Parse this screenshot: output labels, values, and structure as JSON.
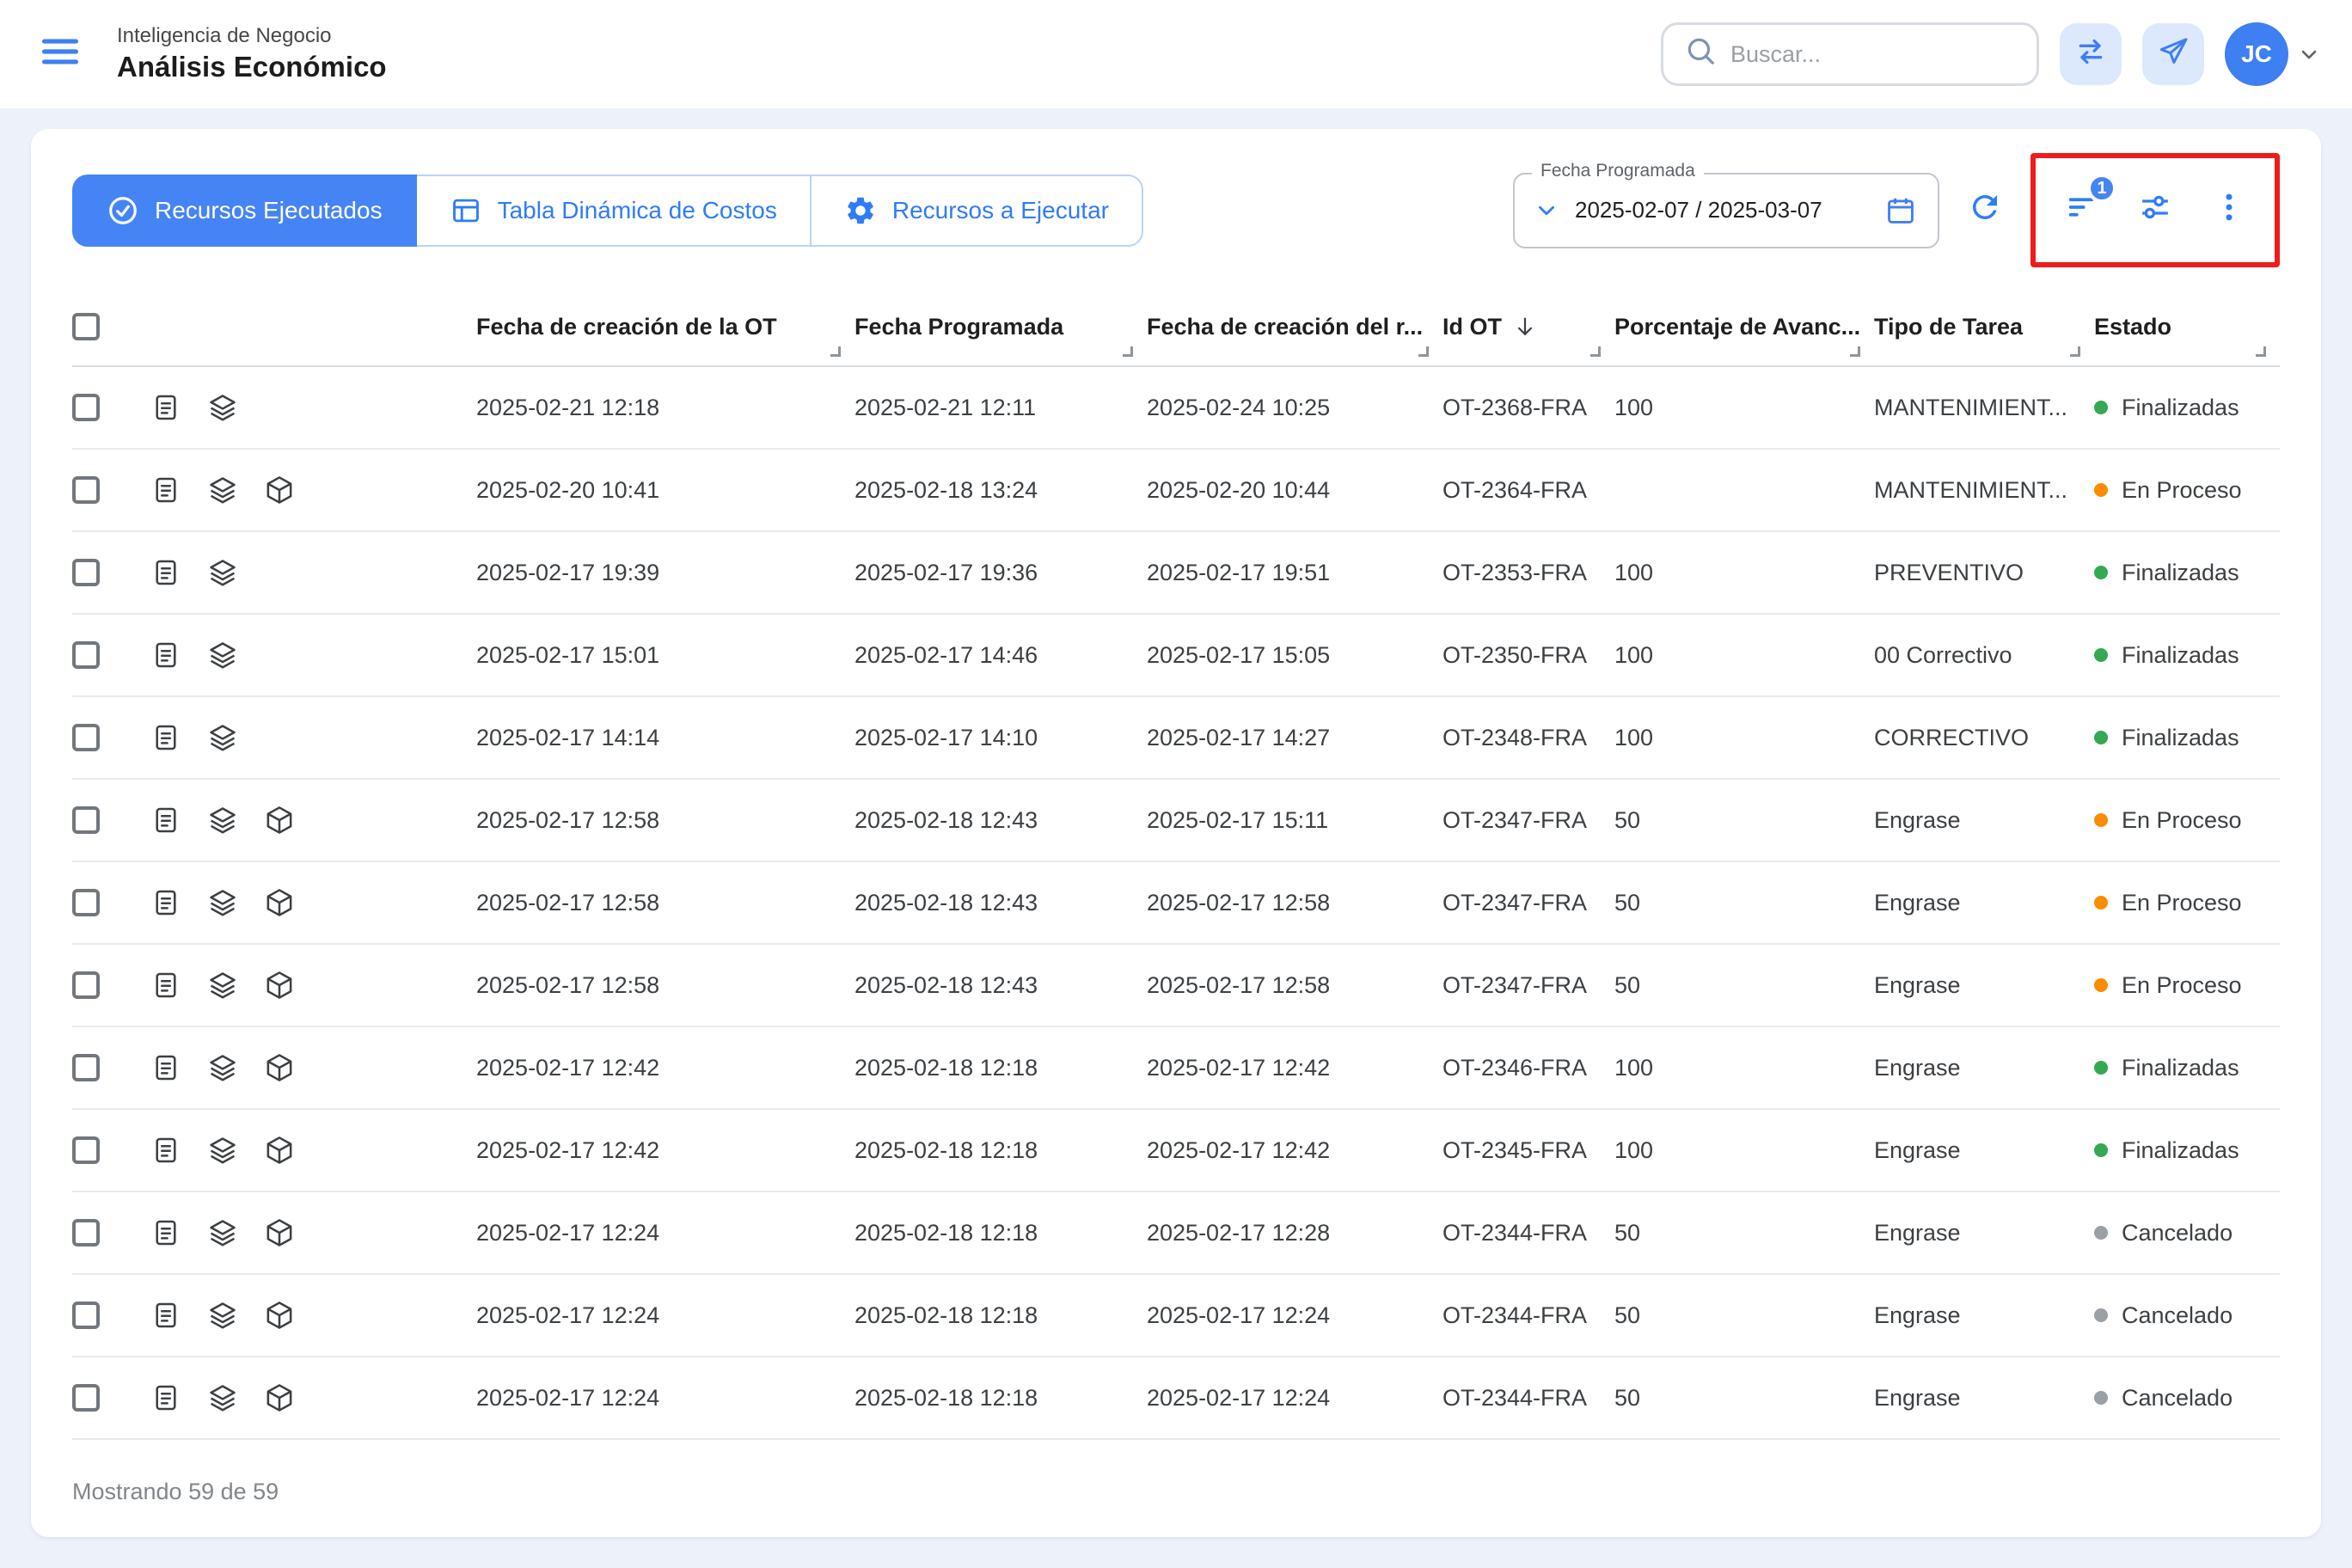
{
  "header": {
    "subtitle": "Inteligencia de Negocio",
    "title": "Análisis Económico",
    "search_placeholder": "Buscar...",
    "avatar_initials": "JC"
  },
  "tabs": [
    {
      "label": "Recursos Ejecutados",
      "icon": "check-circle-icon",
      "active": true
    },
    {
      "label": "Tabla Dinámica de Costos",
      "icon": "pivot-table-icon",
      "active": false
    },
    {
      "label": "Recursos a Ejecutar",
      "icon": "gear-icon",
      "active": false
    }
  ],
  "date_filter": {
    "label": "Fecha Programada",
    "value": "2025-02-07 / 2025-03-07"
  },
  "toolbar_icons": {
    "filter_badge_count": "1",
    "icons": [
      "refresh-icon",
      "filter-sort-icon",
      "tune-icon",
      "kebab-menu-icon"
    ]
  },
  "annotation": {
    "highlight_color": "#ee1c1c"
  },
  "colors": {
    "accent_blue": "#4584f4",
    "icon_blue": "#2f7cf6",
    "page_bg": "#edf1fa",
    "status_green": "#34a853",
    "status_orange": "#fb8c00",
    "status_gray": "#9aa0a6"
  },
  "table": {
    "columns": [
      "Fecha de creación de la OT",
      "Fecha Programada",
      "Fecha de creación del r...",
      "Id OT",
      "Porcentaje de Avanc...",
      "Tipo de Tarea",
      "Estado"
    ],
    "sorted_column": "Id OT",
    "rows": [
      {
        "creacion_ot": "2025-02-21 12:18",
        "programada": "2025-02-21 12:11",
        "creacion_recurso": "2025-02-24 10:25",
        "id_ot": "OT-2368-FRA",
        "porcentaje": "100",
        "tipo": "MANTENIMIENT...",
        "estado": "Finalizadas",
        "estado_color": "green",
        "has_cube": false
      },
      {
        "creacion_ot": "2025-02-20 10:41",
        "programada": "2025-02-18 13:24",
        "creacion_recurso": "2025-02-20 10:44",
        "id_ot": "OT-2364-FRA",
        "porcentaje": "",
        "tipo": "MANTENIMIENT...",
        "estado": "En Proceso",
        "estado_color": "orange",
        "has_cube": true
      },
      {
        "creacion_ot": "2025-02-17 19:39",
        "programada": "2025-02-17 19:36",
        "creacion_recurso": "2025-02-17 19:51",
        "id_ot": "OT-2353-FRA",
        "porcentaje": "100",
        "tipo": "PREVENTIVO",
        "estado": "Finalizadas",
        "estado_color": "green",
        "has_cube": false
      },
      {
        "creacion_ot": "2025-02-17 15:01",
        "programada": "2025-02-17 14:46",
        "creacion_recurso": "2025-02-17 15:05",
        "id_ot": "OT-2350-FRA",
        "porcentaje": "100",
        "tipo": "00 Correctivo",
        "estado": "Finalizadas",
        "estado_color": "green",
        "has_cube": false
      },
      {
        "creacion_ot": "2025-02-17 14:14",
        "programada": "2025-02-17 14:10",
        "creacion_recurso": "2025-02-17 14:27",
        "id_ot": "OT-2348-FRA",
        "porcentaje": "100",
        "tipo": "CORRECTIVO",
        "estado": "Finalizadas",
        "estado_color": "green",
        "has_cube": false
      },
      {
        "creacion_ot": "2025-02-17 12:58",
        "programada": "2025-02-18 12:43",
        "creacion_recurso": "2025-02-17 15:11",
        "id_ot": "OT-2347-FRA",
        "porcentaje": "50",
        "tipo": "Engrase",
        "estado": "En Proceso",
        "estado_color": "orange",
        "has_cube": true
      },
      {
        "creacion_ot": "2025-02-17 12:58",
        "programada": "2025-02-18 12:43",
        "creacion_recurso": "2025-02-17 12:58",
        "id_ot": "OT-2347-FRA",
        "porcentaje": "50",
        "tipo": "Engrase",
        "estado": "En Proceso",
        "estado_color": "orange",
        "has_cube": true
      },
      {
        "creacion_ot": "2025-02-17 12:58",
        "programada": "2025-02-18 12:43",
        "creacion_recurso": "2025-02-17 12:58",
        "id_ot": "OT-2347-FRA",
        "porcentaje": "50",
        "tipo": "Engrase",
        "estado": "En Proceso",
        "estado_color": "orange",
        "has_cube": true
      },
      {
        "creacion_ot": "2025-02-17 12:42",
        "programada": "2025-02-18 12:18",
        "creacion_recurso": "2025-02-17 12:42",
        "id_ot": "OT-2346-FRA",
        "porcentaje": "100",
        "tipo": "Engrase",
        "estado": "Finalizadas",
        "estado_color": "green",
        "has_cube": true
      },
      {
        "creacion_ot": "2025-02-17 12:42",
        "programada": "2025-02-18 12:18",
        "creacion_recurso": "2025-02-17 12:42",
        "id_ot": "OT-2345-FRA",
        "porcentaje": "100",
        "tipo": "Engrase",
        "estado": "Finalizadas",
        "estado_color": "green",
        "has_cube": true
      },
      {
        "creacion_ot": "2025-02-17 12:24",
        "programada": "2025-02-18 12:18",
        "creacion_recurso": "2025-02-17 12:28",
        "id_ot": "OT-2344-FRA",
        "porcentaje": "50",
        "tipo": "Engrase",
        "estado": "Cancelado",
        "estado_color": "gray",
        "has_cube": true
      },
      {
        "creacion_ot": "2025-02-17 12:24",
        "programada": "2025-02-18 12:18",
        "creacion_recurso": "2025-02-17 12:24",
        "id_ot": "OT-2344-FRA",
        "porcentaje": "50",
        "tipo": "Engrase",
        "estado": "Cancelado",
        "estado_color": "gray",
        "has_cube": true
      },
      {
        "creacion_ot": "2025-02-17 12:24",
        "programada": "2025-02-18 12:18",
        "creacion_recurso": "2025-02-17 12:24",
        "id_ot": "OT-2344-FRA",
        "porcentaje": "50",
        "tipo": "Engrase",
        "estado": "Cancelado",
        "estado_color": "gray",
        "has_cube": true
      }
    ]
  },
  "footer": {
    "showing_text": "Mostrando 59 de 59"
  }
}
